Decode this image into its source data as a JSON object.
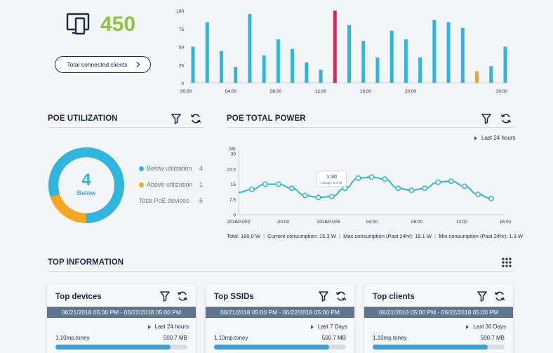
{
  "clients": {
    "count": "450",
    "button_label": "Total connected clients"
  },
  "client_chart": {
    "type": "bar",
    "yticks": [
      "100",
      "75",
      "50",
      "25",
      "0"
    ],
    "xticks": [
      "00:00",
      "04:00",
      "08:00",
      "12:00",
      "16:00",
      "20:00"
    ],
    "values": [
      50,
      84,
      44,
      22,
      95,
      38,
      60,
      47,
      28,
      18,
      100,
      80,
      58,
      35,
      72,
      60,
      35,
      87,
      84,
      76,
      16,
      23,
      50
    ],
    "highlight": {
      "10": "#e0245e",
      "20": "#f5a623"
    },
    "bar_color": "#2fb5de"
  },
  "poe_util": {
    "title": "POE UTILIZATION",
    "center_value": "4",
    "center_label": "Below",
    "below_fraction": 0.8,
    "colors": {
      "below": "#2fb5de",
      "above": "#f5a623"
    },
    "legend": [
      {
        "label": "Below utilization",
        "value": "4"
      },
      {
        "label": "Above utilization",
        "value": "1"
      },
      {
        "label": "Total PoE devices",
        "value": "5"
      }
    ]
  },
  "poe_power": {
    "title": "POE TOTAL POWER",
    "range_label": "Last 24 hours",
    "unit": "(W)",
    "yticks": [
      "30",
      "22.5",
      "15",
      "7.5",
      "0"
    ],
    "xticks": [
      "2018/07/02",
      "20:00",
      "2018/07/03",
      "04:00",
      "08:00",
      "12:00",
      "16:00"
    ],
    "points": [
      11,
      12.5,
      15,
      15,
      13,
      9.5,
      8.5,
      9,
      13,
      18,
      18.5,
      17.5,
      13,
      12,
      13,
      16,
      16.5,
      14,
      10,
      8
    ],
    "tooltip_time": "1:30",
    "tooltip_usage": "Usage: 8.4 W",
    "stats": [
      "Total: 180.0 W",
      "Current consumption: 15.3 W",
      "Max consumption (Past 24hr): 19.1 W",
      "Min consumption (Past 24hr): 1.3 W"
    ]
  },
  "top_info": {
    "title": "TOP INFORMATION"
  },
  "cards": [
    {
      "title": "Top devices",
      "date_range": "06/21/2018 05:00 PM - 06/22/2018 05:00 PM",
      "range": "Last 24 hours",
      "row_name": "1.10mp.toney",
      "row_value": "500.7 MB",
      "fill": 0.87
    },
    {
      "title": "Top SSIDs",
      "date_range": "06/21/2018 05:00 PM - 06/22/2018 05:00 PM",
      "range": "Last 7 Days",
      "row_name": "1.10mp.toney",
      "row_value": "500.7 MB",
      "fill": 0.87
    },
    {
      "title": "Top clients",
      "date_range": "06/21/2018 05:00 PM - 06/22/2018 05:00 PM",
      "range": "Last 30 Days",
      "row_name": "1.10mp.toney",
      "row_value": "500.7 MB",
      "fill": 0.87
    }
  ]
}
